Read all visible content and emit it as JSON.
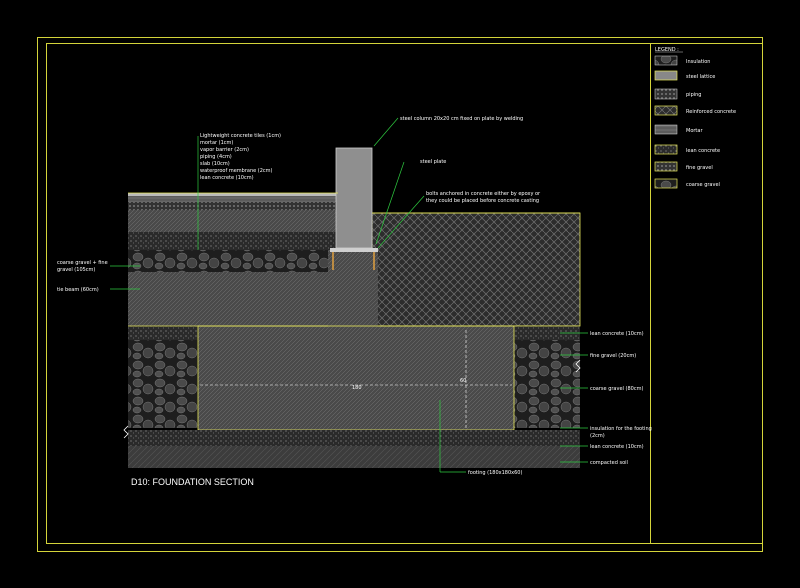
{
  "title": "D10: FOUNDATION SECTION",
  "colors": {
    "frame": "#d4d43a",
    "leader": "#2ecc40",
    "dim": "#ffffff",
    "outline": "#e8e85a",
    "fill_dark": "#3a3a3a",
    "fill_mid": "#555555"
  },
  "legend": {
    "header": "LEGEND :",
    "items": [
      {
        "label": "Insulation",
        "icon": "insulation-swatch"
      },
      {
        "label": "steel lattice",
        "icon": "steel-lattice-swatch"
      },
      {
        "label": "piping",
        "icon": "piping-swatch"
      },
      {
        "label": "Reinforced concrete",
        "icon": "reinforced-concrete-swatch"
      },
      {
        "label": "Mortar",
        "icon": "mortar-swatch"
      },
      {
        "label": "lean concrete",
        "icon": "lean-concrete-swatch"
      },
      {
        "label": "fine gravel",
        "icon": "fine-gravel-swatch"
      },
      {
        "label": "coarse gravel",
        "icon": "coarse-gravel-swatch"
      }
    ]
  },
  "annotations": {
    "layers_top": [
      "Lightweight concrete tiles (1cm)",
      "mortar (1cm)",
      "vapor barrier (2cm)",
      "piping (4cm)",
      "slab (10cm)",
      "waterproof membrane (2cm)",
      "lean concrete (10cm)"
    ],
    "steel_column": "steel column 20x20 cm fixed on plate by welding",
    "steel_plate": "steel plate",
    "bolts": [
      "bolts anchored in concrete either by epoxy or",
      "they could be placed before concrete casting"
    ],
    "coarse_fine_gravel": [
      "coarse gravel + fine",
      "gravel (105cm)"
    ],
    "tie_beam": "tie beam (60cm)",
    "right": {
      "lean_concrete_top": "lean concrete (10cm)",
      "fine_gravel": "fine gravel (20cm)",
      "coarse_gravel": "coarse gravel (80cm)",
      "insulation_footing": [
        "insulation for the footing",
        "(2cm)"
      ],
      "lean_concrete_bottom": "lean concrete (10cm)",
      "compacted_soil": "compacted soil"
    },
    "footing": "footing (180x180x60)",
    "dim_width": "180",
    "dim_height": "60"
  }
}
